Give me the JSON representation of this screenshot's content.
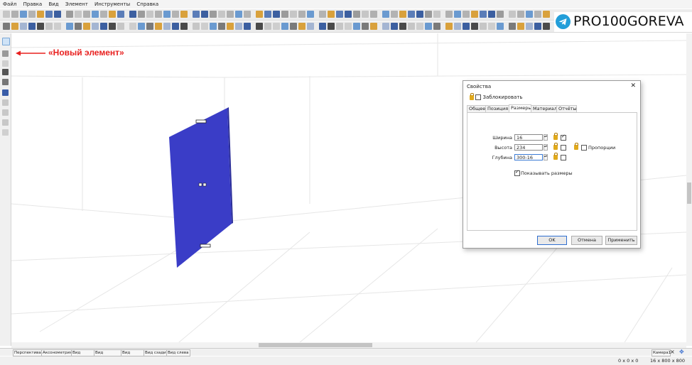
{
  "menu": {
    "items": [
      "Файл",
      "Правка",
      "Вид",
      "Элемент",
      "Инструменты",
      "Справка"
    ]
  },
  "brand": {
    "text": "PRO100GOREVA",
    "icon": "telegram-icon",
    "color": "#229ed9"
  },
  "annotation": {
    "text": "«Новый элемент»",
    "color": "#e8201f"
  },
  "viewport": {
    "panel_color": "#3a3dc7"
  },
  "dialog": {
    "title": "Свойства",
    "lock_label": "Заблокировать",
    "tabs": [
      "Общее",
      "Позиция",
      "Размеры",
      "Материал",
      "Отчёты"
    ],
    "active_tab": "Размеры",
    "fields": [
      {
        "label": "Ширина",
        "value": "16",
        "checked": true
      },
      {
        "label": "Высота",
        "value": "234",
        "checked": false
      },
      {
        "label": "Глубина",
        "value": "300-16",
        "checked": false
      }
    ],
    "proportions_label": "Пропорции",
    "show_dims_label": "Показывать размеры",
    "show_dims_checked": true,
    "ok_label": "OK",
    "cancel_label": "Отмена",
    "apply_label": "Применить"
  },
  "view_tabs": [
    "Перспектива",
    "Аксонометрия",
    "Вид сверху",
    "Вид спереди",
    "Вид справа",
    "Вид сзади",
    "Вид слева"
  ],
  "camera": {
    "label": "Камера1",
    "close": "×"
  },
  "status": {
    "left": "0 x 0 x 0",
    "right": "16 x 800 x 800"
  }
}
